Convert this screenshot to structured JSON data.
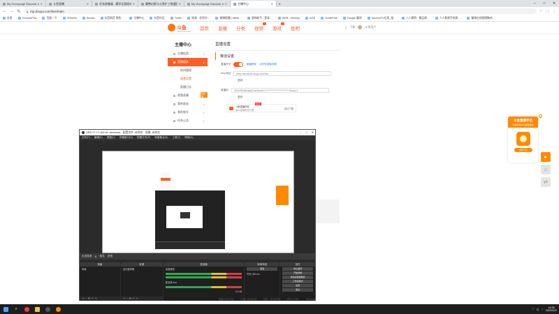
{
  "browser": {
    "tabs": [
      {
        "label": "My Homepage Discover new",
        "active": false
      },
      {
        "label": "斗鱼直播",
        "active": false
      },
      {
        "label": "任务收集器 - 魔术比赛结伴学习…",
        "active": false
      },
      {
        "label": "魔兽幻影与斗鱼扩工联盟信用一览…",
        "active": false
      },
      {
        "label": "My Homepage Discover new",
        "active": false
      },
      {
        "label": "主播中心",
        "active": true
      }
    ],
    "new_tab": "+",
    "window_controls": [
      "–",
      "□",
      "✕"
    ],
    "url": "mp.douyu.com/live/main",
    "nav": {
      "back": "←",
      "forward": "→",
      "reload": "↻"
    },
    "bookmarks": [
      "应用",
      "ChromePlus",
      "百度一下",
      "ZDNd2u",
      "Kimato",
      "抖音网页 那些…",
      "主播中心",
      "抖音社区",
      "Tinder",
      "网易 · 优秀作…",
      "微博直播 | bilibili…",
      "游戏助手 - 登录…",
      "WEB - Monkey",
      "AGE",
      "SouthPark",
      "Google 翻译",
      "AndroidTV应用_批…",
      "八人影院 · 精品视…",
      "人人影视手机版·…",
      "猫咪在线视频聚合…"
    ]
  },
  "site": {
    "logo": "斗鱼",
    "logo_sub": "DOUYU.COM",
    "nav": [
      "首页",
      "直播",
      "分类",
      "视频",
      "游戏",
      "鱼吧"
    ],
    "user": {
      "label": "下载",
      "name": "斗鱼用户"
    }
  },
  "sidebar": {
    "title": "主播中心",
    "items": [
      {
        "label": "主播档案",
        "active": false
      },
      {
        "label": "直播相关",
        "active": true
      },
      {
        "label": "房间管理",
        "sub": true
      },
      {
        "label": "直播设置",
        "sub": true,
        "selected": true
      },
      {
        "label": "直播日志",
        "sub": true
      },
      {
        "label": "视频直播",
        "active": false,
        "flag": "新功能"
      },
      {
        "label": "我的收益",
        "active": false
      },
      {
        "label": "我的账号",
        "active": false
      },
      {
        "label": "任务公告",
        "active": false
      }
    ]
  },
  "content": {
    "title": "直播设置",
    "section": "推流设置",
    "toggle_label": "直播开关",
    "toggle_links": [
      "直播教程",
      "以前的直播流程"
    ],
    "rtmp_label": "rtmp地址",
    "rtmp_value": "rtmp://sendtc3a.douyu.com/live",
    "copy1": "复制",
    "code_label": "直播码",
    "code_value": "1824495rNb2fpdQ?wsSecret=****************************&sub=1",
    "copy2": "复制",
    "promo": {
      "title": "斗鱼直播伴侣",
      "desc": "高清直播轻松开播",
      "badge": "NEW",
      "action": "前往下载"
    }
  },
  "app_promo": {
    "title": "斗鱼直播伴侣",
    "subtitle": "开播更简单 功能更强大",
    "button": "立即下载"
  },
  "obs": {
    "title": "OBS 27.2.2 (64-bit, windows) - 配置文件: 未命名 - 场景: 未命名",
    "menu": [
      "文件(F)",
      "编辑(E)",
      "视图(V)",
      "停靠窗口(D)",
      "配置文件(P)",
      "场景集合(S)",
      "工具(T)",
      "帮助(H)"
    ],
    "toolbar_label": "未选择源",
    "toolbar_items": [
      "属性",
      "滤镜"
    ],
    "docks": {
      "scenes": {
        "title": "场景",
        "items": [
          "场景"
        ]
      },
      "sources": {
        "title": "来源",
        "items": [
          "显示器采集"
        ]
      },
      "mixer": {
        "title": "混音器",
        "items": [
          "桌面音频",
          "麦克风/Aux"
        ],
        "level": "0.0 dB"
      },
      "transitions": {
        "title": "转场特效",
        "items": [
          "渐变",
          "时长"
        ],
        "duration": "300 ms"
      },
      "controls": {
        "title": "控件",
        "buttons": [
          "停止推流",
          "开始录制",
          "启动虚拟摄像机",
          "工作室模式",
          "设置",
          "退出"
        ]
      }
    },
    "status": {
      "live": "LIVE: 00:00:00",
      "rec": "REC: 00:00:00",
      "cpu": "CPU: 0.2%",
      "fps": "30.00 fps",
      "dropped": "丢帧 0 (0.0%)"
    }
  },
  "taskbar": {
    "time": "14:28",
    "date": "2022/3/21",
    "apps": [
      "start",
      "search",
      "chrome",
      "folder",
      "obs",
      "douyu"
    ]
  }
}
